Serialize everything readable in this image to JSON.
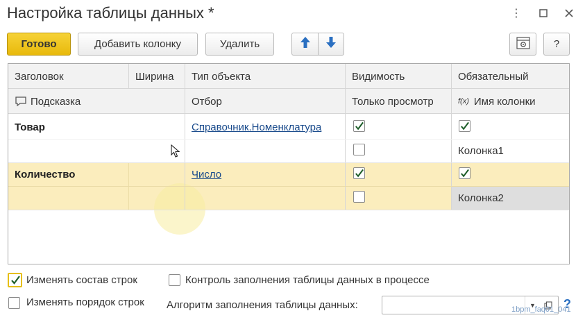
{
  "window": {
    "title": "Настройка таблицы данных *"
  },
  "toolbar": {
    "done_label": "Готово",
    "add_column_label": "Добавить колонку",
    "delete_label": "Удалить",
    "more_label": "?"
  },
  "grid": {
    "header_row1": [
      "Заголовок",
      "Ширина",
      "Тип объекта",
      "Видимость",
      "Обязательный"
    ],
    "header_row2": [
      "Подсказка",
      "Отбор",
      "Только просмотр",
      "Имя колонки"
    ],
    "rows": [
      {
        "title": "Товар",
        "width": "",
        "type": "Справочник.Номенклатура",
        "visible": true,
        "required": true,
        "readonly": false,
        "column_name": "Колонка1"
      },
      {
        "title": "Количество",
        "width": "",
        "type": "Число",
        "visible": true,
        "required": true,
        "readonly": false,
        "column_name": "Колонка2"
      }
    ]
  },
  "options": {
    "change_rows_label": "Изменять состав строк",
    "change_rows_checked": true,
    "change_order_label": "Изменять порядок строк",
    "change_order_checked": false,
    "control_fill_label": "Контроль заполнения таблицы данных в процессе",
    "control_fill_checked": false,
    "algorithm_label": "Алгоритм заполнения таблицы данных:",
    "algorithm_value": "",
    "help_label": "?"
  },
  "watermark": "1bpm_faq01_041",
  "colors": {
    "primary_button": "#f0c419",
    "selected_row": "#fbedbd",
    "link": "#1a4b8c",
    "check": "#1e5e2a"
  }
}
